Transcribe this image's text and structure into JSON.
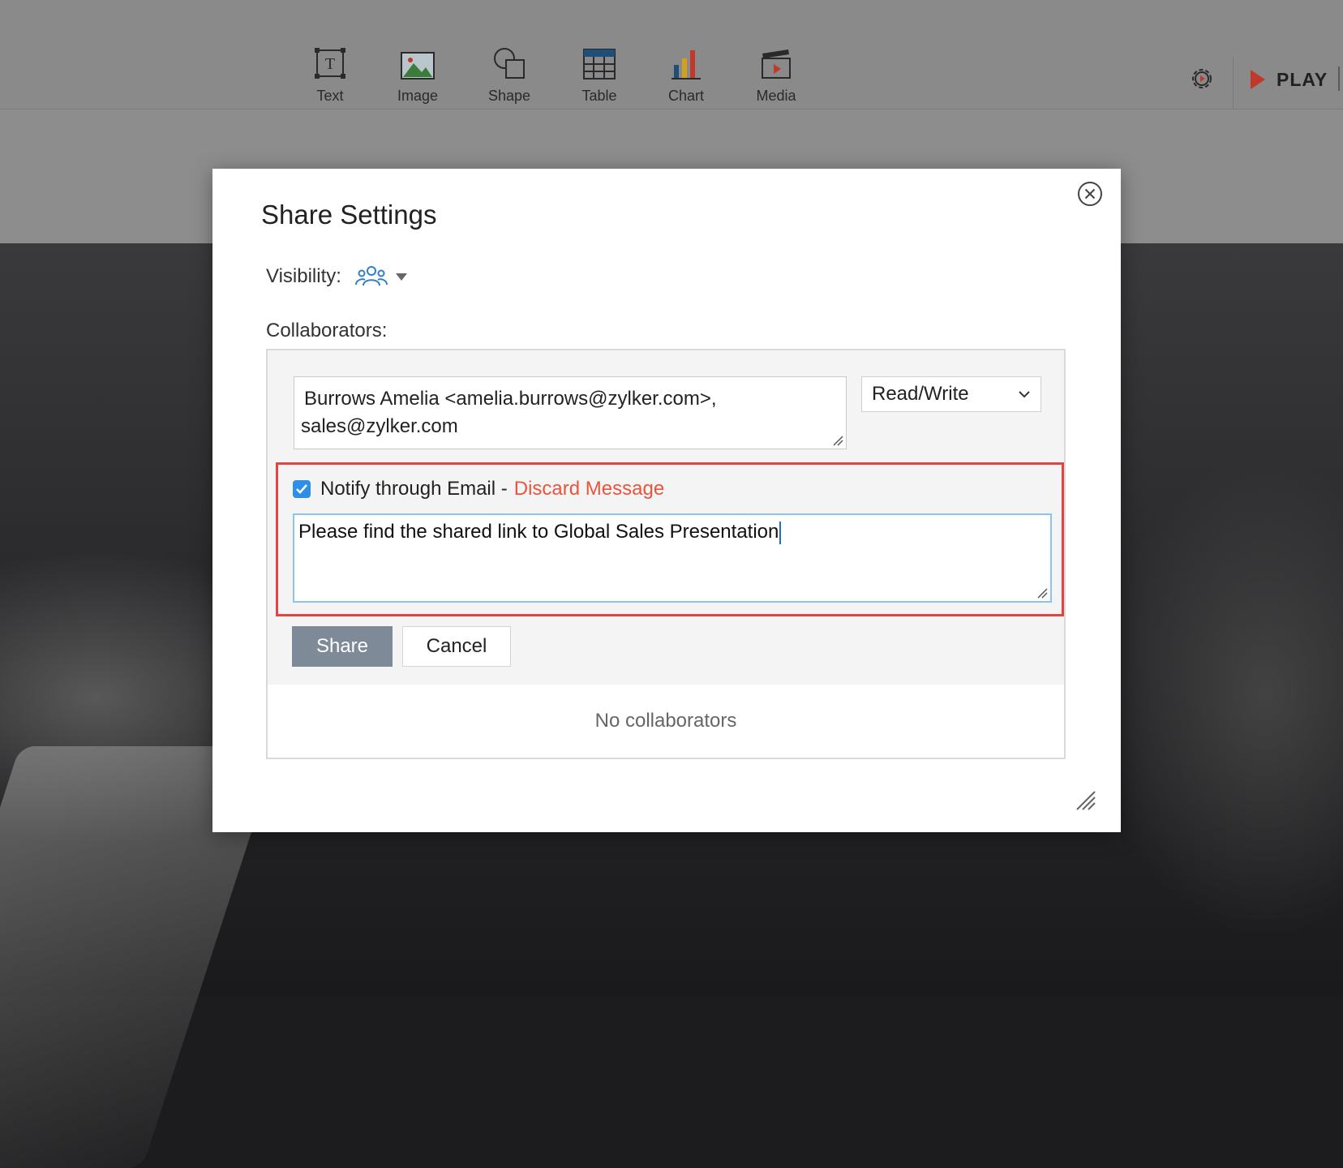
{
  "toolbar": {
    "tools": [
      {
        "label": "Text",
        "icon": "text-box-icon"
      },
      {
        "label": "Image",
        "icon": "image-icon"
      },
      {
        "label": "Shape",
        "icon": "shape-icon"
      },
      {
        "label": "Table",
        "icon": "table-icon"
      },
      {
        "label": "Chart",
        "icon": "chart-icon"
      },
      {
        "label": "Media",
        "icon": "media-clapper-icon"
      }
    ],
    "settings_icon": "gear-icon",
    "play_label": "PLAY",
    "play_icon": "play-triangle-icon"
  },
  "dialog": {
    "title": "Share Settings",
    "visibility_label": "Visibility:",
    "visibility_icon": "people-group-icon",
    "collaborators_label": "Collaborators:",
    "emails": {
      "line1": "Burrows Amelia <amelia.burrows@zylker.com>,",
      "line2": "sales@zylker.com"
    },
    "permission": {
      "selected": "Read/Write"
    },
    "notify": {
      "checked": true,
      "label": "Notify through Email -",
      "discard_label": "Discard Message",
      "message": "Please find the shared link to Global Sales Presentation"
    },
    "share_label": "Share",
    "cancel_label": "Cancel",
    "empty_text": "No collaborators"
  },
  "colors": {
    "highlight_border": "#e24444",
    "link": "#e8553c",
    "checkbox": "#2f8fe6",
    "share_button": "#7f8a99",
    "play_red": "#c0392b"
  }
}
